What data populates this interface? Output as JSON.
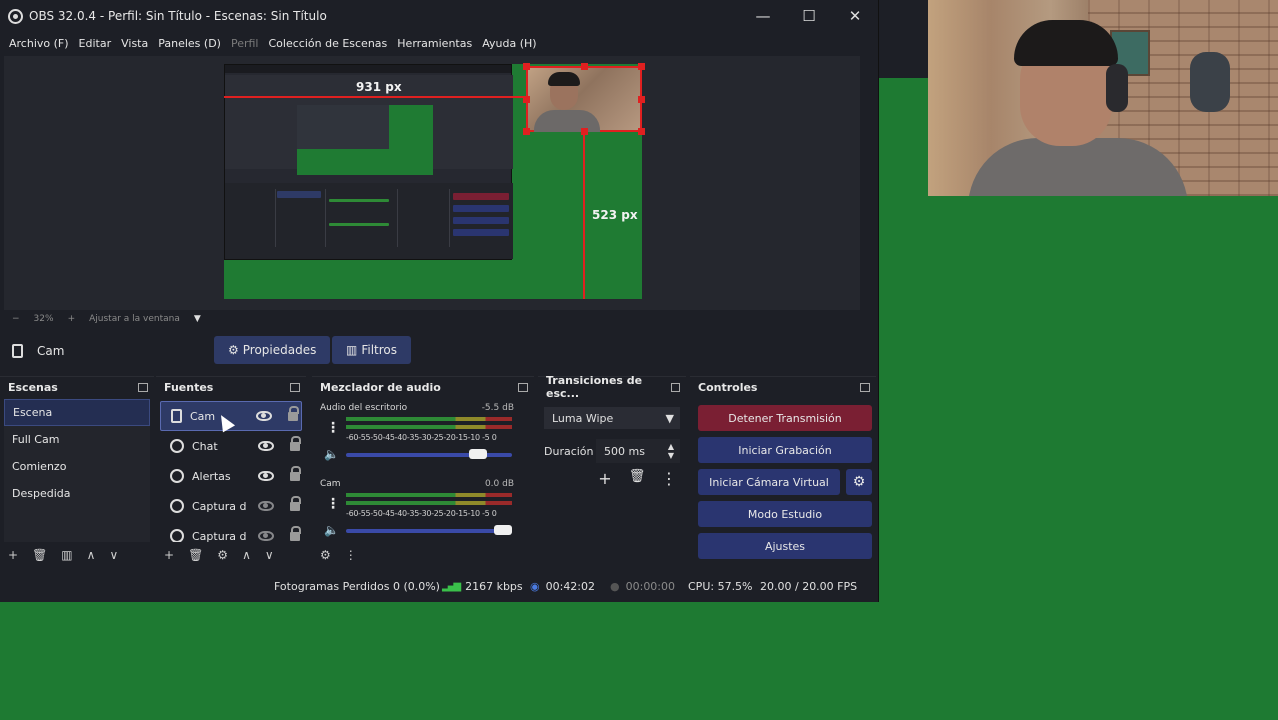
{
  "window": {
    "title": "OBS 32.0.4 - Perfil: Sin Título - Escenas: Sin Título",
    "minimize": "—",
    "maximize": "☐",
    "close": "✕"
  },
  "menu": [
    {
      "label": "Archivo (F)",
      "disabled": false
    },
    {
      "label": "Editar",
      "disabled": false
    },
    {
      "label": "Vista",
      "disabled": false
    },
    {
      "label": "Paneles (D)",
      "disabled": false
    },
    {
      "label": "Perfil",
      "disabled": true
    },
    {
      "label": "Colección de Escenas",
      "disabled": false
    },
    {
      "label": "Herramientas",
      "disabled": false
    },
    {
      "label": "Ayuda (H)",
      "disabled": false
    }
  ],
  "preview": {
    "measure_horizontal": "931 px",
    "measure_vertical": "523 px",
    "zoom_minus": "−",
    "zoom_level": "32%",
    "zoom_plus": "+",
    "fit_label": "Ajustar a la ventana",
    "fit_arrow": "▼"
  },
  "source_toolbar": {
    "selected_source": "Cam",
    "properties_label": "Propiedades",
    "filters_label": "Filtros"
  },
  "scenes": {
    "title": "Escenas",
    "items": [
      {
        "label": "Escena",
        "selected": true
      },
      {
        "label": "Full Cam",
        "selected": false
      },
      {
        "label": "Comienzo",
        "selected": false
      },
      {
        "label": "Despedida",
        "selected": false
      }
    ],
    "footer": [
      "+",
      "🗑",
      "▥",
      "∧",
      "∨"
    ]
  },
  "sources": {
    "title": "Fuentes",
    "items": [
      {
        "label": "Cam",
        "selected": true,
        "visible": true
      },
      {
        "label": "Chat",
        "selected": false,
        "visible": true
      },
      {
        "label": "Alertas",
        "selected": false,
        "visible": true
      },
      {
        "label": "Captura d",
        "selected": false,
        "visible": false
      },
      {
        "label": "Captura d",
        "selected": false,
        "visible": false
      }
    ],
    "footer": [
      "+",
      "🗑",
      "⚙",
      "∧",
      "∨"
    ]
  },
  "mixer": {
    "title": "Mezclador de audio",
    "tracks": [
      {
        "name": "Audio del escritorio",
        "db": "-5.5 dB",
        "volume": 0.85
      },
      {
        "name": "Cam",
        "db": "0.0 dB",
        "volume": 1.0
      }
    ],
    "ticks": "-60-55-50-45-40-35-30-25-20-15-10 -5  0",
    "footer": [
      "⚙",
      "⋮"
    ]
  },
  "transitions": {
    "title": "Transiciones de esc...",
    "selected": "Luma Wipe",
    "duration_label": "Duración",
    "duration_value": "500 ms",
    "add": "+",
    "remove": "🗑",
    "more": "⋮"
  },
  "controls": {
    "title": "Controles",
    "stop_stream": "Detener Transmisión",
    "start_recording": "Iniciar Grabación",
    "virtual_camera": "Iniciar Cámara Virtual",
    "studio_mode": "Modo Estudio",
    "settings": "Ajustes"
  },
  "status": {
    "dropped_frames": "Fotogramas Perdidos 0 (0.0%)",
    "bitrate": "2167 kbps",
    "stream_time": "00:42:02",
    "record_time": "00:00:00",
    "cpu": "CPU: 57.5%",
    "fps": "20.00 / 20.00 FPS"
  },
  "colors": {
    "background_green": "#1e7a32",
    "obs_bg": "#1d1f26",
    "accent_blue": "#2e3a66",
    "stop_red": "#7a1f33",
    "guide_red": "#e02020"
  }
}
